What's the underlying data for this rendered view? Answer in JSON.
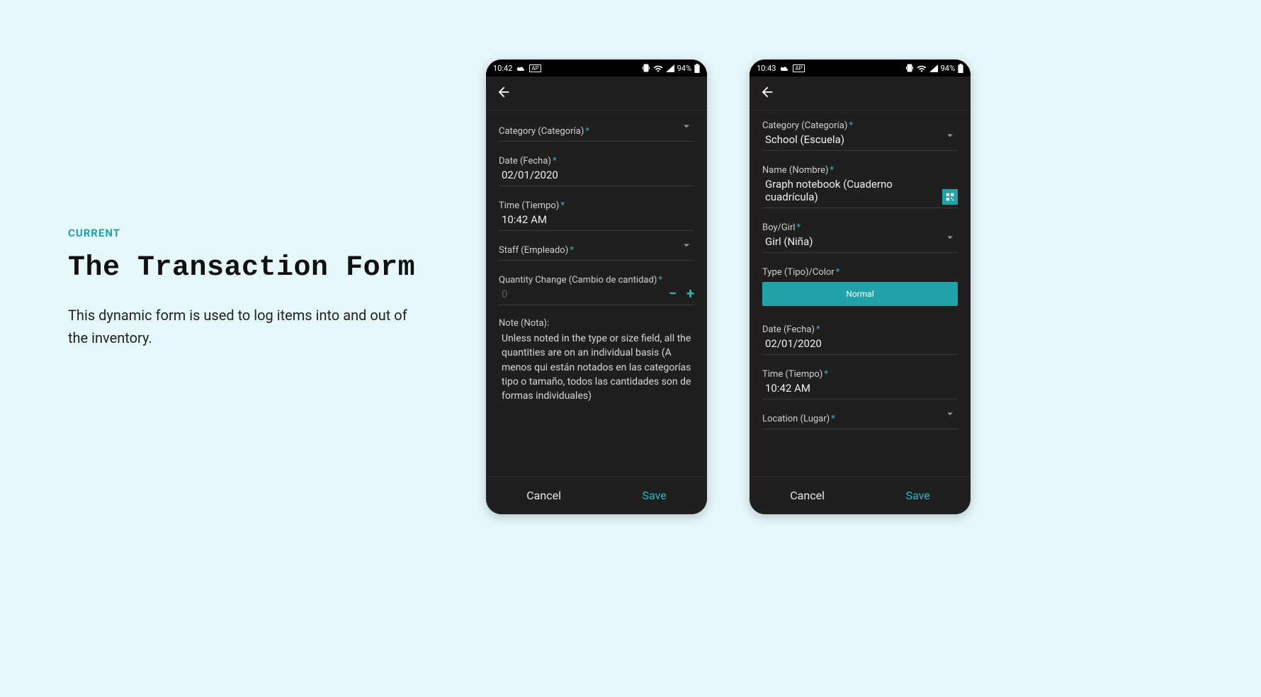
{
  "copy": {
    "eyebrow": "CURRENT",
    "headline": "The Transaction Form",
    "body": "This dynamic form is used to log items into and out of the inventory."
  },
  "status": {
    "time_a": "10:42",
    "time_b": "10:43",
    "battery": "94%"
  },
  "form_a": {
    "category_label": "Category (Categoría)",
    "date_label": "Date (Fecha)",
    "date_value": "02/01/2020",
    "time_label": "Time (Tiempo)",
    "time_value": "10:42 AM",
    "staff_label": "Staff (Empleado)",
    "qty_label": "Quantity Change (Cambio de cantidad)",
    "qty_placeholder": "0",
    "note_label": "Note (Nota):",
    "note_value": "Unless noted in the type or size field, all the quantities are on an individual basis (A menos qui están notados en las categorías tipo o tamaño, todos las cantidades son de formas individuales)"
  },
  "form_b": {
    "category_label": "Category (Categoría)",
    "category_value": "School (Escuela)",
    "name_label": "Name (Nombre)",
    "name_value": "Graph notebook (Cuaderno cuadrícula)",
    "boygirl_label": "Boy/Girl",
    "boygirl_value": "Girl (Niña)",
    "typecolor_label": "Type (Tipo)/Color",
    "typecolor_chip": "Normal",
    "date_label": "Date (Fecha)",
    "date_value": "02/01/2020",
    "time_label": "Time (Tiempo)",
    "time_value": "10:42 AM",
    "location_label": "Location (Lugar)"
  },
  "footer": {
    "cancel": "Cancel",
    "save": "Save"
  },
  "colors": {
    "accent": "#1fa2a8",
    "bg": "#e6f7f9"
  }
}
